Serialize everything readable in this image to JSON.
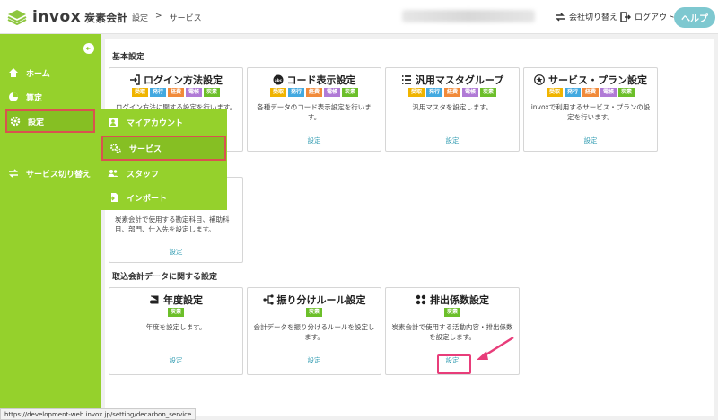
{
  "header": {
    "logo_text": "invox",
    "logo_sub": "炭素会計",
    "breadcrumb": [
      "設定",
      ">",
      "サービス"
    ],
    "switch_company": "会社切り替え",
    "logout": "ログアウト",
    "help": "ヘルプ"
  },
  "sidebar": {
    "items": [
      {
        "label": "ホーム",
        "icon": "home-icon"
      },
      {
        "label": "算定",
        "icon": "pie-chart-icon"
      },
      {
        "label": "設定",
        "icon": "gear-icon"
      },
      {
        "label": "サービス切り替え",
        "icon": "swap-icon"
      }
    ]
  },
  "submenu": {
    "items": [
      {
        "label": "マイアカウント",
        "icon": "user-icon"
      },
      {
        "label": "サービス",
        "icon": "cogs-icon"
      },
      {
        "label": "スタッフ",
        "icon": "users-icon"
      },
      {
        "label": "インポート",
        "icon": "file-import-icon"
      }
    ]
  },
  "sections": {
    "basic": "基本設定",
    "import": "取込会計データに関する設定"
  },
  "tags": {
    "jyu": "受取",
    "hak": "発行",
    "kei": "経費",
    "den": "電帳",
    "tan": "炭素"
  },
  "cards": {
    "login": {
      "title": "ログイン方法設定",
      "desc": "ログイン方法に関する設定を行います。",
      "link": "設定"
    },
    "code": {
      "title": "コード表示設定",
      "desc": "各種データのコード表示設定を行います。",
      "link": "設定"
    },
    "master": {
      "title": "汎用マスタグループ",
      "desc": "汎用マスタを設定します。",
      "link": "設定"
    },
    "plan": {
      "title": "サービス・プラン設定",
      "desc": "invoxで利用するサービス・プランの設定を行います。",
      "link": "設定"
    },
    "account": {
      "desc": "炭素会計で使用する勘定科目、補助科目、部門、仕入先を設定します。",
      "link": "設定"
    },
    "year": {
      "title": "年度設定",
      "desc": "年度を設定します。",
      "link": "設定"
    },
    "rule": {
      "title": "振り分けルール設定",
      "desc": "会計データを振り分けるルールを設定します。",
      "link": "設定"
    },
    "emission": {
      "title": "排出係数設定",
      "desc": "炭素会計で使用する活動内容・排出係数を設定します。",
      "link": "設定"
    }
  },
  "status_url": "https://development-web.invox.jp/setting/decarbon_service",
  "colors": {
    "sidebar": "#95d12c",
    "accent": "#3aa0b5",
    "highlight": "#d9534f",
    "arrow": "#e83d7a"
  }
}
